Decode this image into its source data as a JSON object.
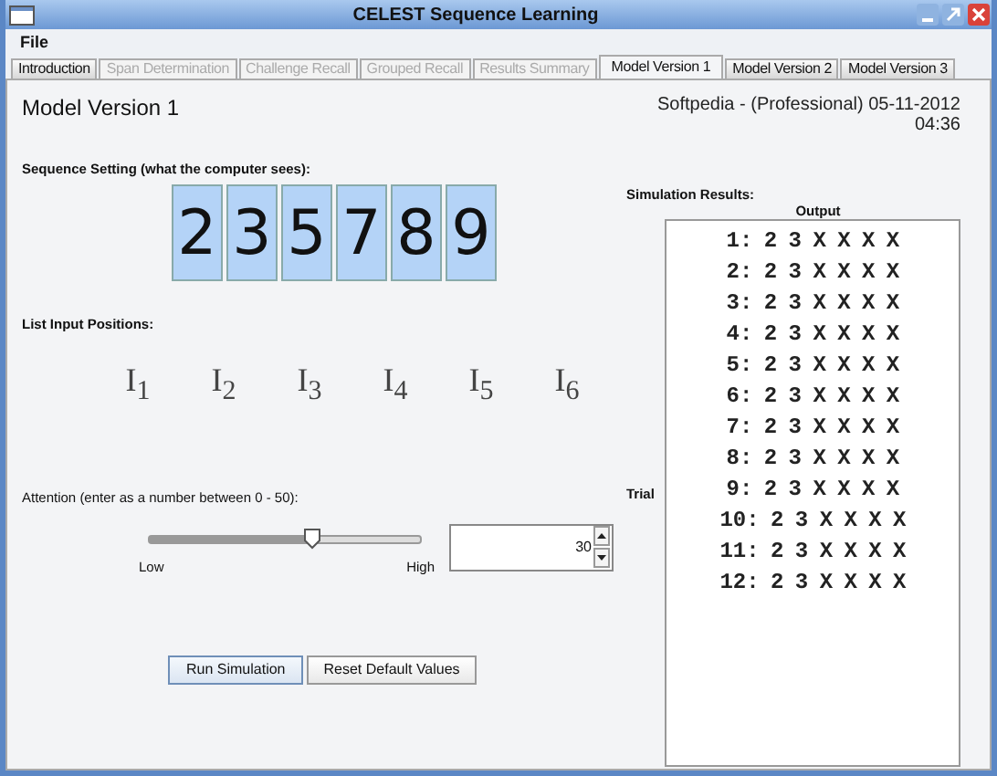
{
  "window": {
    "title": "CELEST Sequence Learning"
  },
  "menu": [
    "File"
  ],
  "tabs": [
    {
      "label": "Introduction",
      "selected": false,
      "disabled": false
    },
    {
      "label": "Span Determination",
      "selected": false,
      "disabled": true
    },
    {
      "label": "Challenge Recall",
      "selected": false,
      "disabled": true
    },
    {
      "label": "Grouped Recall",
      "selected": false,
      "disabled": true
    },
    {
      "label": "Results Summary",
      "selected": false,
      "disabled": true
    },
    {
      "label": "Model Version 1",
      "selected": true,
      "disabled": false
    },
    {
      "label": "Model Version 2",
      "selected": false,
      "disabled": false
    },
    {
      "label": "Model Version 3",
      "selected": false,
      "disabled": false
    }
  ],
  "heading": "Model Version 1",
  "info": "Softpedia - (Professional)  05-11-2012  04:36",
  "sequence": {
    "label": "Sequence Setting (what the computer sees):",
    "digits": [
      "2",
      "3",
      "5",
      "7",
      "8",
      "9"
    ]
  },
  "positions": {
    "label": "List Input Positions:",
    "items": [
      "I$_{1}$",
      "I$_{2}$",
      "I$_{3}$",
      "I$_{4}$",
      "I$_{5}$",
      "I$_{6}$"
    ]
  },
  "attention": {
    "label": "Attention (enter as a number between 0 - 50):",
    "level": 0.6,
    "low": "Low",
    "high": "High",
    "value": "30"
  },
  "buttons": [
    {
      "label": "Run Simulation",
      "focused": true
    },
    {
      "label": "Reset Default Values",
      "focused": false
    }
  ],
  "results": {
    "label": "Simulation Results:",
    "column": "Output",
    "row_label": "Trial",
    "rows": [
      "1: 2 3 X X X X",
      "2: 2 3 X X X X",
      "3: 2 3 X X X X",
      "4: 2 3 X X X X",
      "5: 2 3 X X X X",
      "6: 2 3 X X X X",
      "7: 2 3 X X X X",
      "8: 2 3 X X X X",
      "9: 2 3 X X X X",
      "10: 2 3 X X X X",
      "11: 2 3 X X X X",
      "12: 2 3 X X X X"
    ]
  }
}
